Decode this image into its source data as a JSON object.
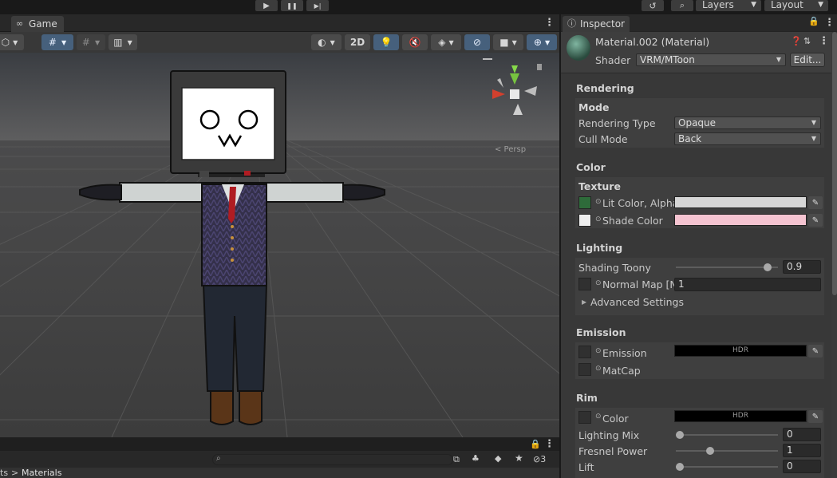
{
  "top_toolbar": {
    "play_icon": "play-icon",
    "pause_icon": "pause-icon",
    "step_icon": "step-icon",
    "play_glyph": "▶",
    "pause_glyph": "❚❚",
    "step_glyph": "▶|",
    "history_glyph": "↺",
    "search_glyph": "⌕",
    "layers_label": "Layers",
    "layout_label": "Layout"
  },
  "scene": {
    "tab_label": "Game",
    "toolbar_2d_label": "2D",
    "gizmo_label": "< Persp"
  },
  "project": {
    "breadcrumb_root": "ts",
    "breadcrumb_sep": ">",
    "breadcrumb_current": "Materials",
    "search_placeholder": "",
    "hidden_count": "3"
  },
  "inspector": {
    "tab_label": "Inspector",
    "material_name": "Material.002 (Material)",
    "shader_label": "Shader",
    "shader_value": "VRM/MToon",
    "edit_button": "Edit...",
    "sections": {
      "rendering": "Rendering",
      "color": "Color",
      "lighting": "Lighting",
      "emission": "Emission",
      "rim": "Rim"
    },
    "mode_title": "Mode",
    "rendering_type_label": "Rendering Type",
    "rendering_type_value": "Opaque",
    "cull_mode_label": "Cull Mode",
    "cull_mode_value": "Back",
    "texture_title": "Texture",
    "lit_color_label": "Lit Color, Alpha",
    "shade_color_label": "Shade Color",
    "shading_toony_label": "Shading Toony",
    "shading_toony_value": "0.9",
    "shading_toony_fraction": 0.9,
    "normal_map_label": "Normal Map [Nc",
    "normal_map_value": "1",
    "advanced_settings_label": "Advanced Settings",
    "emission_label": "Emission",
    "emission_hdr": "HDR",
    "matcap_label": "MatCap",
    "rim_color_label": "Color",
    "rim_hdr": "HDR",
    "lighting_mix_label": "Lighting Mix",
    "lighting_mix_value": "0",
    "fresnel_power_label": "Fresnel Power",
    "fresnel_power_value": "1",
    "lift_label": "Lift",
    "lift_value": "0"
  },
  "colors": {
    "lit_color": "#d6d6d6",
    "shade_color": "#f5c4d1",
    "emission_color": "#000000",
    "rim_color": "#000000",
    "accent_blue": "#46607c"
  }
}
